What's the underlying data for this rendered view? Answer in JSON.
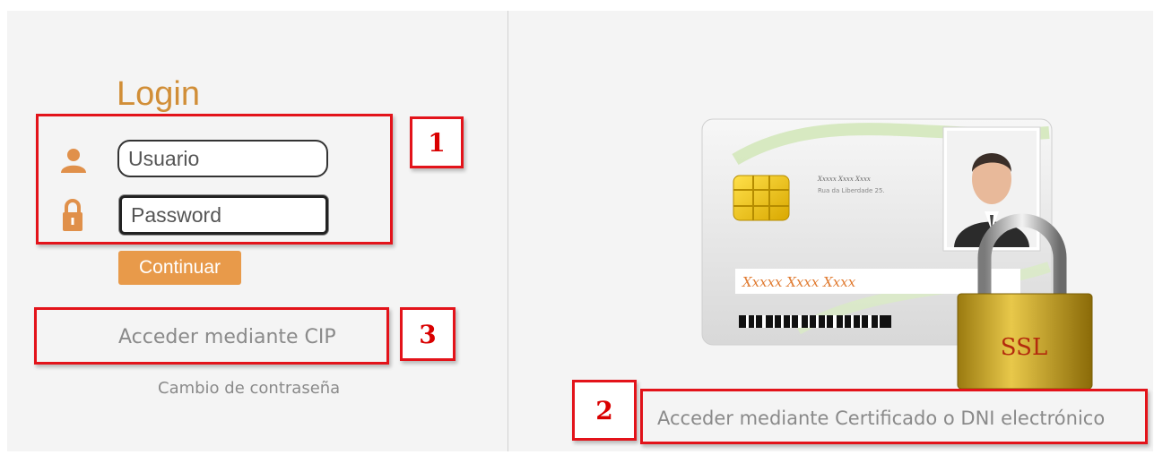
{
  "login": {
    "title": "Login",
    "username_placeholder": "Usuario",
    "password_placeholder": "Password",
    "continue_label": "Continuar"
  },
  "links": {
    "cip": "Acceder mediante CIP",
    "change_password": "Cambio de contraseña",
    "certificate": "Acceder mediante Certificado o DNI electrónico"
  },
  "annotations": {
    "n1": "1",
    "n2": "2",
    "n3": "3"
  },
  "card": {
    "name_line": "Xxxxx Xxxx Xxxx",
    "address_line": "Rua da Liberdade 25.",
    "signature": "Xxxxx Xxxx Xxxx",
    "lock_text": "SSL"
  },
  "colors": {
    "accent": "#d18e37",
    "button": "#e89a4a",
    "annotation": "#e3131a",
    "link": "#8a8a8a"
  },
  "icons": [
    "user-icon",
    "lock-icon",
    "padlock-icon",
    "chip-icon",
    "barcode-icon",
    "person-photo-icon"
  ]
}
